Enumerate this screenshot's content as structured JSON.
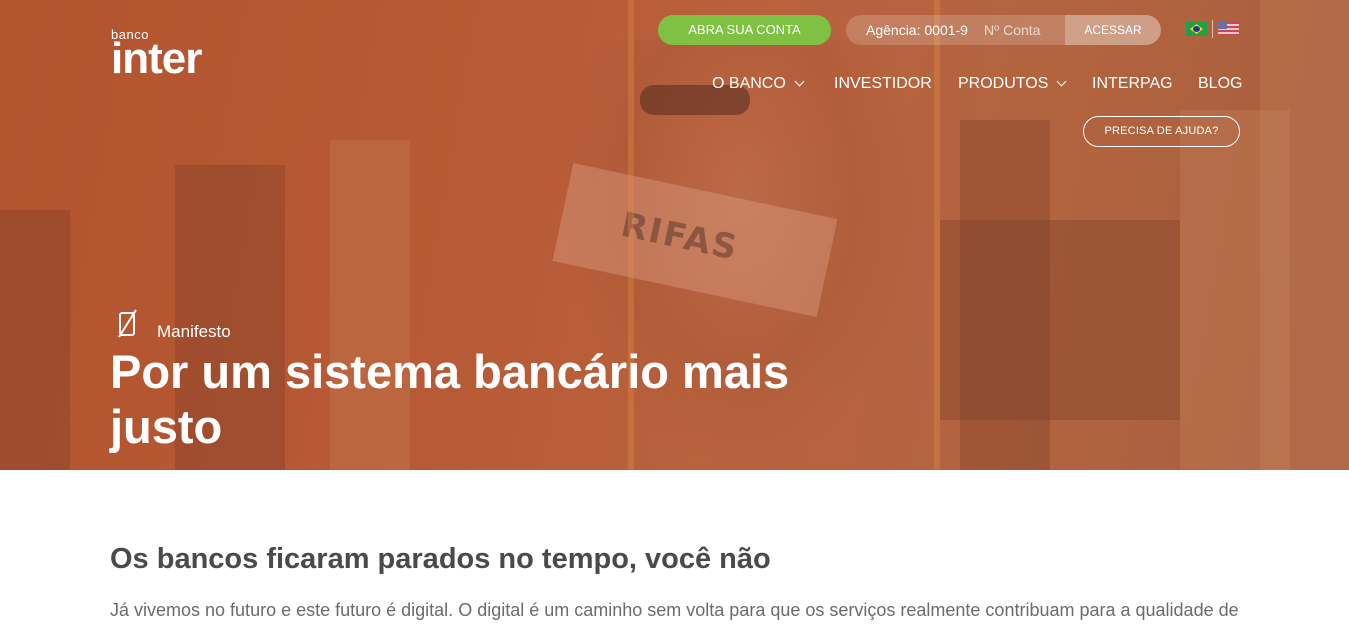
{
  "brand": {
    "small": "banco",
    "big": "inter"
  },
  "header": {
    "open_account": "ABRA SUA CONTA",
    "agency": "Agência: 0001-9",
    "account_placeholder": "Nº Conta",
    "access": "ACESSAR",
    "help": "PRECISA DE AJUDA?"
  },
  "nav": {
    "items": [
      {
        "label": "O BANCO"
      },
      {
        "label": "INVESTIDOR"
      },
      {
        "label": "PRODUTOS"
      },
      {
        "label": "INTERPAG"
      },
      {
        "label": "BLOG"
      }
    ]
  },
  "hero": {
    "photo_sign_text": "RIFAS",
    "section_label": "Manifesto",
    "title": "Por um sistema bancário mais justo"
  },
  "content": {
    "heading": "Os bancos ficaram parados no tempo, você não",
    "paragraph": "Já vivemos no futuro e este futuro é digital. O digital é um caminho sem volta para que os serviços realmente contribuam para a qualidade de"
  },
  "colors": {
    "hero_overlay": "#b75a35",
    "cta_green": "#7ec143",
    "heading_text": "#4a4a4a",
    "body_text": "#6b6b6b"
  },
  "icons": [
    "manifesto-zero-icon",
    "chevron-down-icon",
    "brazil-flag-icon",
    "usa-flag-icon"
  ]
}
